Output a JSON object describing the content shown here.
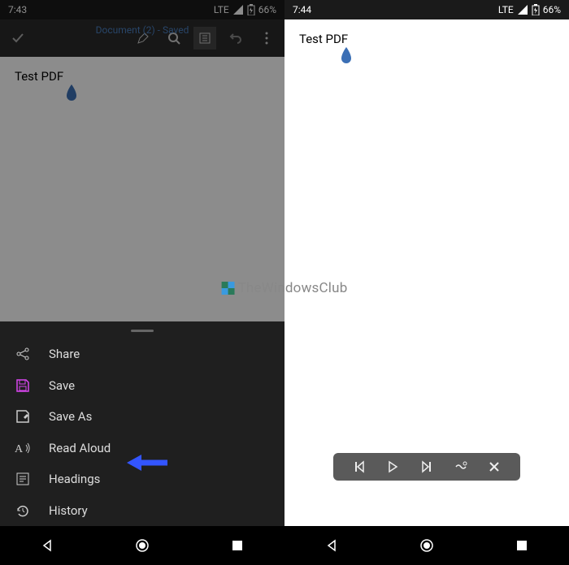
{
  "left": {
    "status": {
      "time": "7:43",
      "network": "LTE",
      "battery": "66%"
    },
    "appbar": {
      "title": "Document (2) - Saved"
    },
    "doc": {
      "text": "Test PDF"
    },
    "sheet": {
      "items": [
        {
          "icon": "share-icon",
          "label": "Share"
        },
        {
          "icon": "save-icon",
          "label": "Save"
        },
        {
          "icon": "saveas-icon",
          "label": "Save As"
        },
        {
          "icon": "readaloud-icon",
          "label": "Read Aloud"
        },
        {
          "icon": "headings-icon",
          "label": "Headings"
        },
        {
          "icon": "history-icon",
          "label": "History"
        }
      ]
    }
  },
  "right": {
    "status": {
      "time": "7:44",
      "network": "LTE",
      "battery": "66%"
    },
    "doc": {
      "text": "Test PDF"
    }
  },
  "watermark": {
    "text": "TheWindowsClub"
  }
}
